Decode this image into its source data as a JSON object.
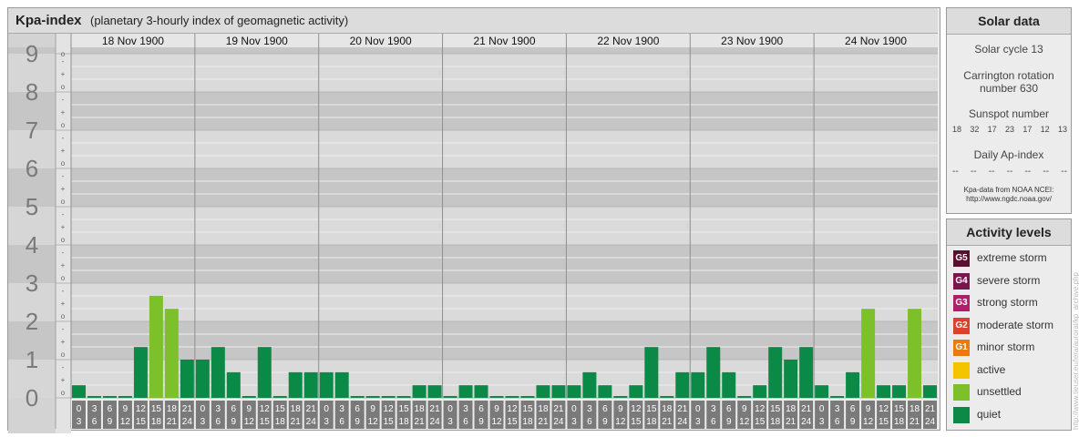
{
  "title": {
    "main": "Kpa-index",
    "sub": "(planetary 3-hourly index of geomagnetic activity)"
  },
  "chart_data": {
    "type": "bar",
    "days": [
      "18 Nov 1900",
      "19 Nov 1900",
      "20 Nov 1900",
      "21 Nov 1900",
      "22 Nov 1900",
      "23 Nov 1900",
      "24 Nov 1900"
    ],
    "interval_start": [
      "0",
      "3",
      "6",
      "9",
      "12",
      "15",
      "18",
      "21"
    ],
    "interval_end": [
      "3",
      "6",
      "9",
      "12",
      "15",
      "18",
      "21",
      "24"
    ],
    "y_ticks": [
      "0",
      "1",
      "2",
      "3",
      "4",
      "5",
      "6",
      "7",
      "8",
      "9"
    ],
    "y_minor": [
      "+",
      "o",
      "-"
    ],
    "ylim": [
      0,
      9
    ],
    "values": [
      0.33,
      0,
      0,
      0,
      1.33,
      2.67,
      2.33,
      1,
      1,
      1.33,
      0.67,
      0,
      1.33,
      0,
      0.67,
      0.67,
      0.67,
      0.67,
      0,
      0,
      0,
      0,
      0.33,
      0.33,
      0,
      0.33,
      0.33,
      0,
      0,
      0,
      0.33,
      0.33,
      0.33,
      0.67,
      0.33,
      0,
      0.33,
      1.33,
      0,
      0.67,
      0.67,
      1.33,
      0.67,
      0,
      0.33,
      1.33,
      1,
      1.33,
      0.33,
      0,
      0.67,
      2.33,
      0.33,
      0.33,
      2.33,
      0.33
    ],
    "colors": {
      "quiet": "#0a8a46",
      "unsettled": "#7dc12a"
    }
  },
  "solar": {
    "heading": "Solar data",
    "cycle": "Solar cycle 13",
    "rotation": [
      "Carrington rotation",
      "number 630"
    ],
    "sunspot_label": "Sunspot number",
    "sunspots": [
      "18",
      "32",
      "17",
      "23",
      "17",
      "12",
      "13"
    ],
    "ap_label": "Daily Ap-index",
    "ap_values": [
      "--",
      "--",
      "--",
      "--",
      "--",
      "--",
      "--"
    ],
    "source": [
      "Kpa-data from NOAA NCEI:",
      "http://www.ngdc.noaa.gov/"
    ]
  },
  "levels": {
    "heading": "Activity levels",
    "items": [
      {
        "badge": "G5",
        "label": "extreme storm",
        "color": "#5a0f2e"
      },
      {
        "badge": "G4",
        "label": "severe storm",
        "color": "#7b1550"
      },
      {
        "badge": "G3",
        "label": "strong storm",
        "color": "#b01f6b"
      },
      {
        "badge": "G2",
        "label": "moderate storm",
        "color": "#d8442a"
      },
      {
        "badge": "G1",
        "label": "minor storm",
        "color": "#e87a14"
      },
      {
        "badge": "",
        "label": "active",
        "color": "#f5c400"
      },
      {
        "badge": "",
        "label": "unsettled",
        "color": "#7dc12a"
      },
      {
        "badge": "",
        "label": "quiet",
        "color": "#0a8a46"
      }
    ]
  },
  "credit": "http://www.tieuser.eu/lera/auroral/kp_archive.php"
}
